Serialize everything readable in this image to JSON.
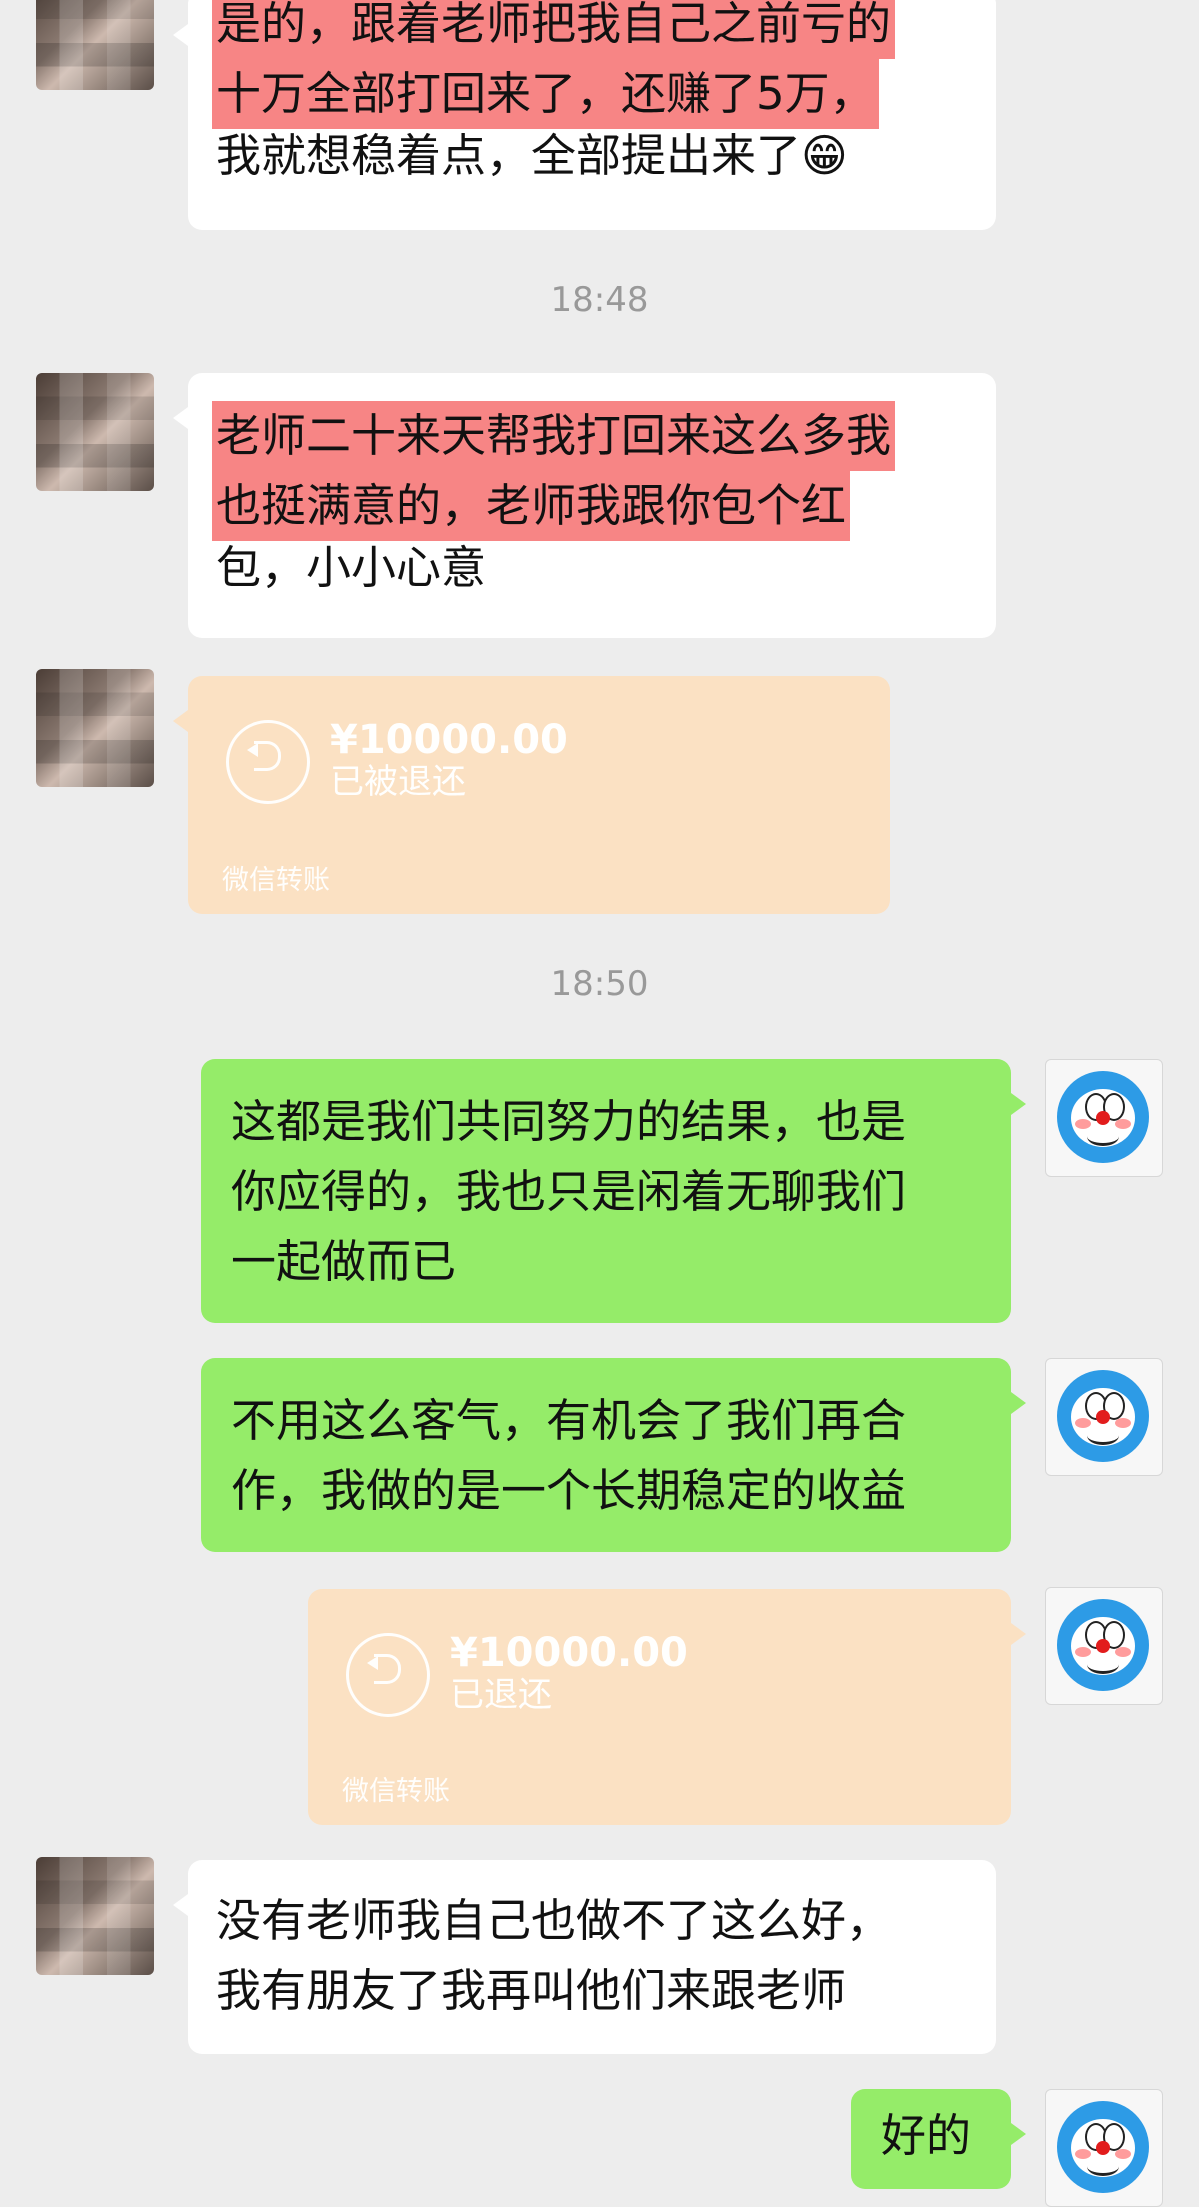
{
  "messages": [
    {
      "lines": [
        {
          "text": "是的，跟着老师把我自己之前亏的",
          "highlight": true
        },
        {
          "text": "十万全部打回来了，还赚了5万，",
          "highlight": true
        },
        {
          "text": "我就想稳着点，全部提出来了😁",
          "highlight": false
        }
      ]
    },
    {
      "lines": [
        {
          "text": "老师二十来天帮我打回来这么多我",
          "highlight": true
        },
        {
          "text": "也挺满意的，老师我跟你包个红",
          "highlight": true
        },
        {
          "text": "包，小小心意",
          "highlight": false
        }
      ]
    },
    {
      "amount": "¥10000.00",
      "status": "已被退还",
      "footer": "微信转账"
    },
    {
      "lines": [
        "这都是我们共同努力的结果，也是",
        "你应得的，我也只是闲着无聊我们",
        "一起做而已"
      ]
    },
    {
      "lines": [
        "不用这么客气，有机会了我们再合",
        "作，我做的是一个长期稳定的收益"
      ]
    },
    {
      "amount": "¥10000.00",
      "status": "已退还",
      "footer": "微信转账"
    },
    {
      "lines": [
        "没有老师我自己也做不了这么好，",
        "我有朋友了我再叫他们来跟老师"
      ]
    },
    {
      "text": "好的"
    }
  ],
  "timestamps": [
    "18:48",
    "18:50"
  ]
}
